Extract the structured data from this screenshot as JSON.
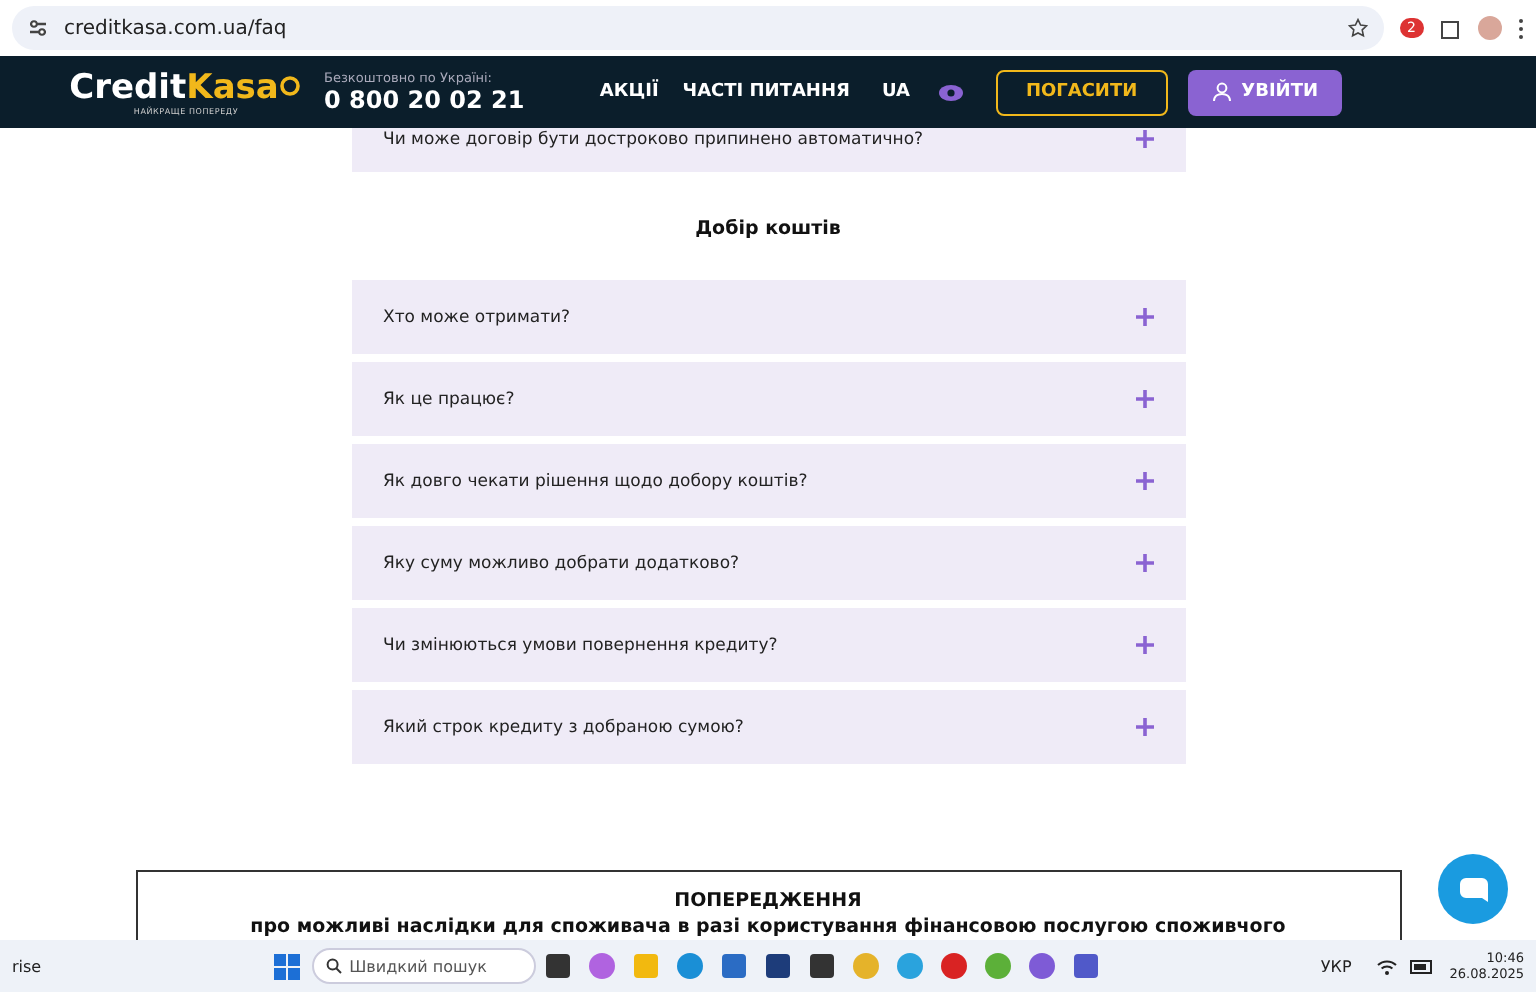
{
  "browser": {
    "url": "creditkasa.com.ua/faq",
    "extension_badge": "2"
  },
  "header": {
    "logo": {
      "first": "Credit",
      "second": "Kasa",
      "tagline": "НАЙКРАЩЕ ПОПЕРЕДУ"
    },
    "phone_label": "Безкоштовно по Україні:",
    "phone": "0 800 20 02 21",
    "nav": [
      "АКЦІЇ",
      "ЧАСТІ ПИТАННЯ"
    ],
    "language": {
      "label": "UA",
      "selected": true
    },
    "pay_button": "ПОГАСИТИ",
    "login_button": "УВІЙТИ"
  },
  "faq": {
    "partial_question": "Чи може договір бути достроково припинено автоматично?",
    "section_title": "Добір коштів",
    "questions": [
      {
        "text": "Хто може отримати?",
        "expanded": false
      },
      {
        "text": "Як це працює?",
        "expanded": false
      },
      {
        "text": "Як довго чекати рішення щодо добору коштів?",
        "expanded": false
      },
      {
        "text": "Яку суму можливо добрати додатково?",
        "expanded": false
      },
      {
        "text": "Чи змінюються умови повернення кредиту?",
        "expanded": false
      },
      {
        "text": "Який строк кредиту з добраною сумою?",
        "expanded": false
      }
    ]
  },
  "warning": {
    "title": "ПОПЕРЕДЖЕННЯ",
    "lines": [
      "про можливі наслідки для споживача в разі користування фінансовою послугою споживчого"
    ]
  },
  "taskbar": {
    "widget_text": "rise",
    "search_placeholder": "Швидкий пошук",
    "language": "УКР",
    "time": "10:46",
    "date": "26.08.2025"
  }
}
